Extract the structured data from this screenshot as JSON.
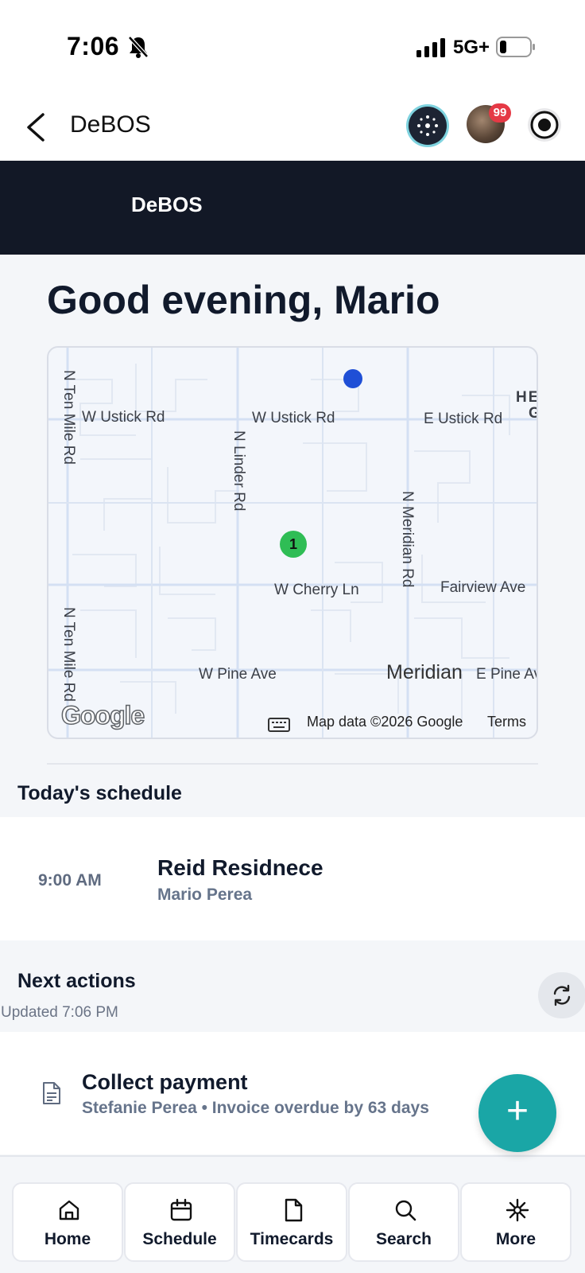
{
  "status_bar": {
    "time": "7:06",
    "network": "5G+"
  },
  "header": {
    "title": "DeBOS",
    "notification_count": "99"
  },
  "banner": {
    "title": "DeBOS"
  },
  "greeting": "Good evening, Mario",
  "map": {
    "roads": {
      "w_ustick_left": "W Ustick Rd",
      "w_ustick_mid": "W Ustick Rd",
      "e_ustick": "E Ustick Rd",
      "n_ten_mile_top": "N Ten Mile Rd",
      "n_linder": "N Linder Rd",
      "n_meridian": "N Meridian Rd",
      "w_cherry": "W Cherry Ln",
      "fairview": "Fairview Ave",
      "n_ten_mile_bottom": "N Ten Mile Rd",
      "w_pine": "W Pine Ave",
      "e_pine": "E Pine Av",
      "he_label": "HE",
      "g_label": "G"
    },
    "city": "Meridian",
    "pin_number": "1",
    "logo": "Google",
    "attribution": "Map data ©2026 Google",
    "terms": "Terms"
  },
  "schedule": {
    "title": "Today's schedule",
    "items": [
      {
        "time": "9:00 AM",
        "title": "Reid Residnece",
        "assignee": "Mario Perea"
      }
    ]
  },
  "next_actions": {
    "title": "Next actions",
    "updated": "Updated 7:06 PM",
    "items": [
      {
        "title": "Collect payment",
        "detail": "Stefanie Perea • Invoice overdue by 63 days"
      }
    ]
  },
  "fab_label": "+",
  "bottom_nav": [
    {
      "label": "Home",
      "icon": "home-icon"
    },
    {
      "label": "Schedule",
      "icon": "calendar-icon"
    },
    {
      "label": "Timecards",
      "icon": "document-icon"
    },
    {
      "label": "Search",
      "icon": "search-icon"
    },
    {
      "label": "More",
      "icon": "sparkle-icon"
    }
  ],
  "colors": {
    "banner": "#121826",
    "accent": "#1aa6a6",
    "badge": "#e53945",
    "pin": "#2fbd55",
    "user_dot": "#1f4fd6"
  }
}
